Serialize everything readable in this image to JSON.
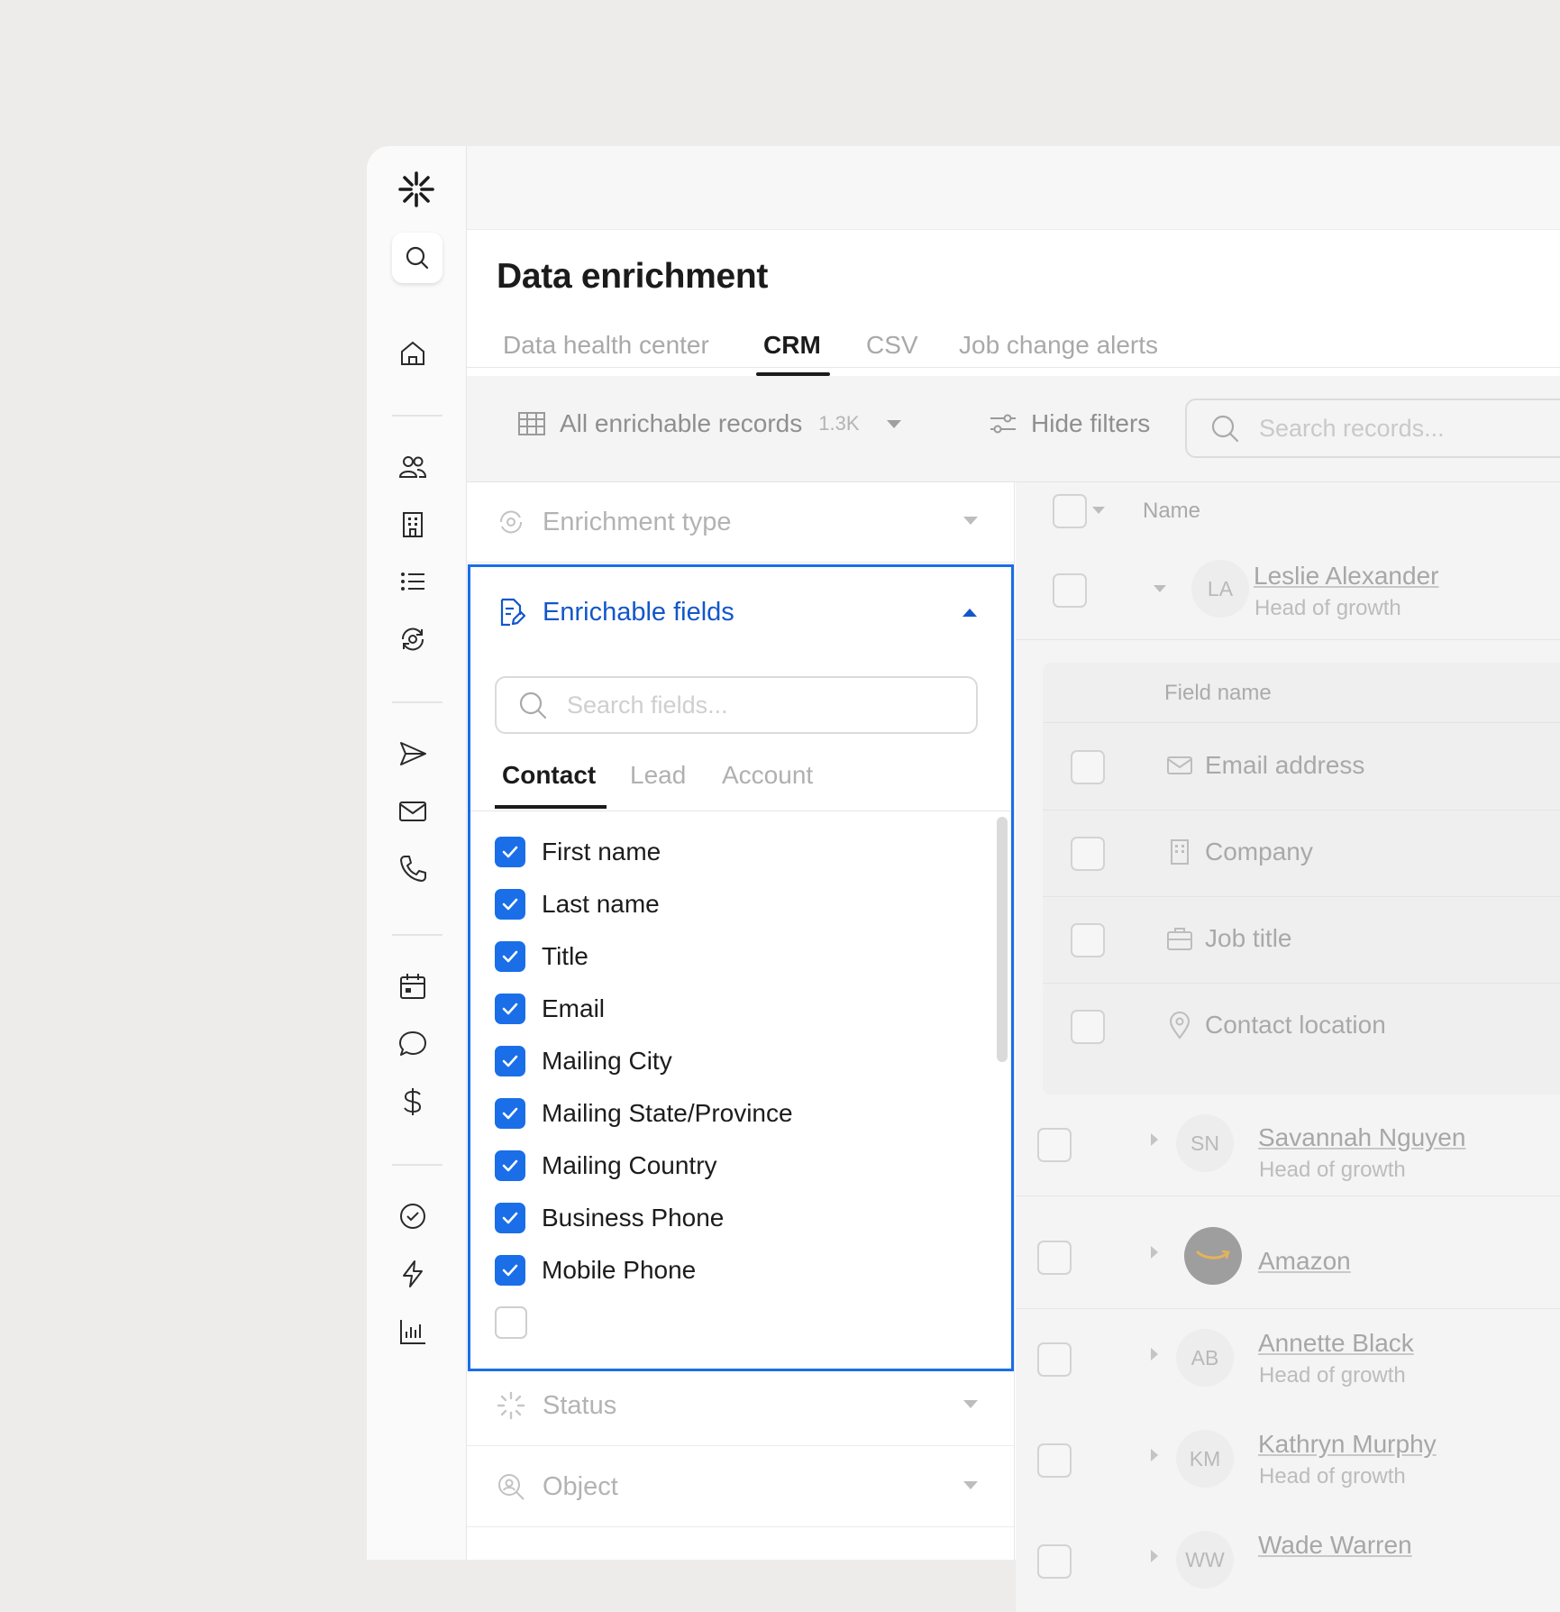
{
  "page": {
    "title": "Data enrichment"
  },
  "tabs": [
    {
      "label": "Data health center",
      "active": false
    },
    {
      "label": "CRM",
      "active": true
    },
    {
      "label": "CSV",
      "active": false
    },
    {
      "label": "Job change alerts",
      "active": false
    }
  ],
  "toolbar": {
    "records_label": "All enrichable records",
    "records_count": "1.3K",
    "hide_filters_label": "Hide filters",
    "search_placeholder": "Search records..."
  },
  "filters": {
    "enrichment_type": "Enrichment type",
    "enrichable_fields": {
      "title": "Enrichable fields",
      "search_placeholder": "Search fields...",
      "subtabs": [
        {
          "label": "Contact",
          "active": true
        },
        {
          "label": "Lead",
          "active": false
        },
        {
          "label": "Account",
          "active": false
        }
      ],
      "fields": [
        {
          "label": "First name",
          "checked": true
        },
        {
          "label": "Last name",
          "checked": true
        },
        {
          "label": "Title",
          "checked": true
        },
        {
          "label": "Email",
          "checked": true
        },
        {
          "label": "Mailing City",
          "checked": true
        },
        {
          "label": "Mailing State/Province",
          "checked": true
        },
        {
          "label": "Mailing Country",
          "checked": true
        },
        {
          "label": "Business Phone",
          "checked": true
        },
        {
          "label": "Mobile Phone",
          "checked": true
        }
      ]
    },
    "status": "Status",
    "object": "Object"
  },
  "table": {
    "header_name": "Name",
    "subtable": {
      "header": "Field name",
      "rows": [
        {
          "label": "Email address",
          "icon": "mail-icon"
        },
        {
          "label": "Company",
          "icon": "building-icon"
        },
        {
          "label": "Job title",
          "icon": "briefcase-icon"
        },
        {
          "label": "Contact location",
          "icon": "pin-icon"
        }
      ]
    },
    "rows": [
      {
        "initials": "LA",
        "name": "Leslie Alexander",
        "role": "Head of growth",
        "expanded": true
      },
      {
        "initials": "SN",
        "name": "Savannah Nguyen",
        "role": "Head of growth"
      },
      {
        "initials": "",
        "name": "Amazon",
        "role": "",
        "logo": "amazon-logo"
      },
      {
        "initials": "AB",
        "name": "Annette Black",
        "role": "Head of growth"
      },
      {
        "initials": "KM",
        "name": "Kathryn Murphy",
        "role": "Head of growth"
      },
      {
        "initials": "WW",
        "name": "Wade Warren",
        "role": ""
      }
    ]
  },
  "colors": {
    "accent": "#1a6ee8",
    "accent_text": "#1257c9",
    "background": "#edecea"
  }
}
